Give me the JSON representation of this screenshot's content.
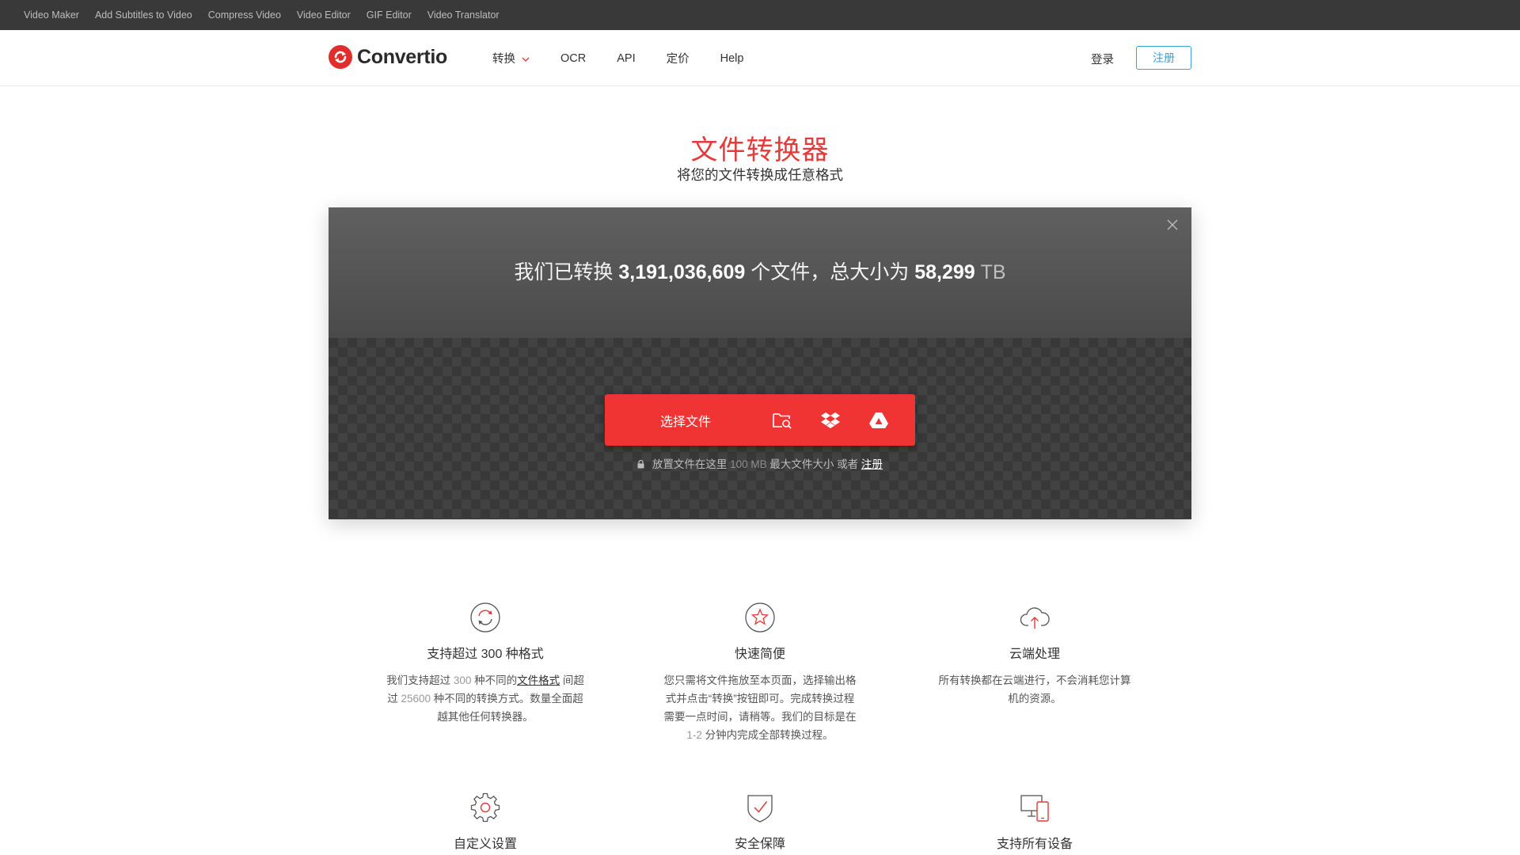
{
  "topbar": {
    "links": [
      "Video Maker",
      "Add Subtitles to Video",
      "Compress Video",
      "Video Editor",
      "GIF Editor",
      "Video Translator"
    ]
  },
  "header": {
    "logo_text": "Convertio",
    "nav": [
      "转换",
      "OCR",
      "API",
      "定价",
      "Help"
    ],
    "login": "登录",
    "signup": "注册"
  },
  "hero": {
    "title": "文件转换器",
    "subtitle": "将您的文件转换成任意格式"
  },
  "stats": {
    "prefix": "我们已转换",
    "files": "3,191,036,609",
    "middle": "个文件，总大小为",
    "size": "58,299",
    "unit": "TB"
  },
  "upload": {
    "choose_label": "选择文件",
    "note_prefix": "放置文件在这里",
    "note_size": "100 MB",
    "note_middle": "最大文件大小 或者",
    "note_link": "注册"
  },
  "features": [
    {
      "title": "支持超过 300 种格式",
      "desc_a": "我们支持超过",
      "num_a": "300",
      "desc_b": "种不同的",
      "link": "文件格式",
      "desc_c": "间超过",
      "num_b": "25600",
      "desc_d": "种不同的转换方式。数量全面超越其他任何转换器。"
    },
    {
      "title": "快速简便",
      "desc_a": "您只需将文件拖放至本页面，选择输出格式并点击“转换”按钮即可。完成转换过程需要一点时间，请稍等。我们的目标是在",
      "num_a": "1-2",
      "desc_b": "分钟内完成全部转换过程。"
    },
    {
      "title": "云端处理",
      "desc_a": "所有转换都在云端进行，不会消耗您计算机的资源。"
    },
    {
      "title": "自定义设置"
    },
    {
      "title": "安全保障"
    },
    {
      "title": "支持所有设备"
    }
  ],
  "colors": {
    "brand_red": "#f03434",
    "title_red": "#e63a3a",
    "signup_blue": "#38a0d8",
    "topbar": "#393939"
  }
}
